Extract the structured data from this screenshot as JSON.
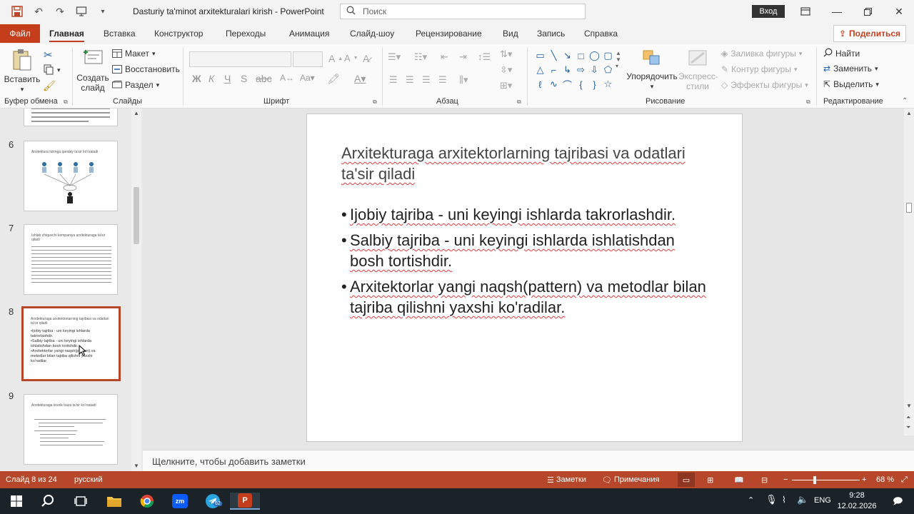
{
  "window": {
    "title": "Dasturiy ta'minot arxitekturalari kirish  -  PowerPoint",
    "search_placeholder": "Поиск",
    "login": "Вход"
  },
  "menu": {
    "file": "Файл",
    "tabs": [
      "Главная",
      "Вставка",
      "Конструктор",
      "Переходы",
      "Анимация",
      "Слайд-шоу",
      "Рецензирование",
      "Вид",
      "Запись",
      "Справка"
    ],
    "active": "Главная",
    "share": "Поделиться"
  },
  "ribbon": {
    "clipboard": {
      "paste": "Вставить",
      "label": "Буфер обмена"
    },
    "slides": {
      "new_slide": "Создать слайд",
      "layout": "Макет",
      "reset": "Восстановить",
      "section": "Раздел",
      "label": "Слайды"
    },
    "font": {
      "label": "Шрифт",
      "bold": "Ж",
      "italic": "К",
      "underline": "Ч",
      "shadow": "S"
    },
    "paragraph": {
      "label": "Абзац"
    },
    "drawing": {
      "arrange": "Упорядочить",
      "quick_styles": "Экспресс-стили",
      "fill": "Заливка фигуры",
      "outline": "Контур фигуры",
      "effects": "Эффекты фигуры",
      "label": "Рисование"
    },
    "editing": {
      "find": "Найти",
      "replace": "Заменить",
      "select": "Выделить",
      "label": "Редактирование"
    }
  },
  "thumbnails": [
    {
      "num": "6",
      "title": "Arxitektura tizimga qanday ta'sir ko'rsatadi"
    },
    {
      "num": "7",
      "title": "Ishlab chiquvchi kompaniya arxitekturaga ta'sir qiladi"
    },
    {
      "num": "8",
      "title": "Arxitekturaga arxitektorlarning tajribasi va odatlari ta'sir qiladi",
      "bullets": [
        "•Ijobiy tajriba - uni keyingi ishlarda takrorlashdir.",
        "•Salbiy tajriba - uni keyingi ishlarda ishlatishdan bosh tortishdir.",
        "•Arxitektorlar yangi naqsh(pattern) va metodlar bilan tajriba qilishni yaxshi ko'radilar."
      ]
    },
    {
      "num": "9",
      "title": "Arxitekturaga texnik baza ta'sir ko'rsatadi"
    }
  ],
  "slide": {
    "title": "Arxitekturaga arxitektorlarning tajribasi va odatlari ta'sir qiladi",
    "bullets": [
      "Ijobiy tajriba -  uni keyingi ishlarda takrorlashdir.",
      "Salbiy tajriba - uni keyingi ishlarda ishlatishdan bosh tortishdir.",
      "Arxitektorlar yangi naqsh(pattern) va metodlar bilan tajriba qilishni yaxshi ko'radilar."
    ]
  },
  "notes_placeholder": "Щелкните, чтобы добавить заметки",
  "status": {
    "slide_counter": "Слайд 8 из 24",
    "language": "русский",
    "notes": "Заметки",
    "comments": "Примечания",
    "zoom": "68 %"
  },
  "taskbar": {
    "lang": "ENG",
    "time": "9:28",
    "date": "12.02.2026",
    "telegram_badge": "62"
  },
  "colors": {
    "accent": "#b7472a",
    "file_tab": "#c43e1c",
    "taskbar": "#1b2329"
  }
}
